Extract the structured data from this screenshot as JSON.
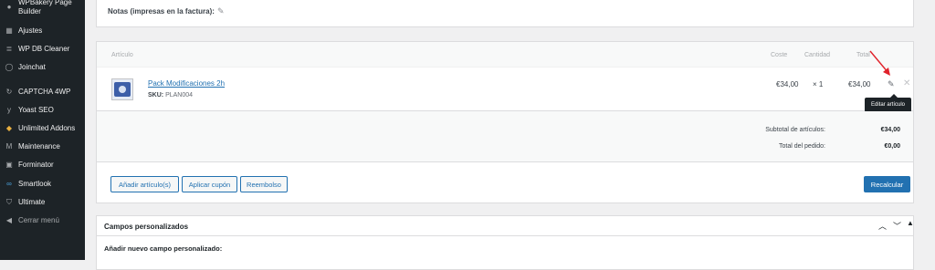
{
  "sidebar": {
    "items": [
      {
        "label": "WPBakery Page Builder",
        "icon": "wpbakery-icon"
      },
      {
        "label": "Ajustes",
        "icon": "settings-icon"
      },
      {
        "label": "WP DB Cleaner",
        "icon": "database-icon"
      },
      {
        "label": "Joinchat",
        "icon": "chat-icon"
      },
      {
        "label": "CAPTCHA 4WP",
        "icon": "captcha-icon"
      },
      {
        "label": "Yoast SEO",
        "icon": "yoast-icon"
      },
      {
        "label": "Unlimited Addons",
        "icon": "addons-icon"
      },
      {
        "label": "Maintenance",
        "icon": "maintenance-icon"
      },
      {
        "label": "Forminator",
        "icon": "forminator-icon"
      },
      {
        "label": "Smartlook",
        "icon": "smartlook-icon"
      },
      {
        "label": "Ultimate",
        "icon": "shield-icon"
      },
      {
        "label": "Cerrar menú",
        "icon": "collapse-icon"
      }
    ]
  },
  "notes": {
    "label": "Notas (impresas en la factura):"
  },
  "items": {
    "headers": {
      "article": "Artículo",
      "cost": "Coste",
      "qty": "Cantidad",
      "total": "Total"
    },
    "row": {
      "name": "Pack Modificaciones 2h",
      "sku_label": "SKU:",
      "sku": "PLAN004",
      "cost": "€34,00",
      "qty": "× 1",
      "total": "€34,00"
    },
    "tooltip": "Editar artículo",
    "totals": {
      "subtotal_label": "Subtotal de artículos:",
      "subtotal": "€34,00",
      "order_label": "Total del pedido:",
      "order": "€0,00"
    },
    "buttons": {
      "add": "Añadir artículo(s)",
      "coupon": "Aplicar cupón",
      "refund": "Reembolso",
      "recalc": "Recalcular"
    }
  },
  "custom_fields": {
    "title": "Campos personalizados",
    "add_new": "Añadir nuevo campo personalizado:"
  },
  "colors": {
    "accent": "#2271b1",
    "sidebar_bg": "#1d2327",
    "annotation": "#e0222b"
  }
}
